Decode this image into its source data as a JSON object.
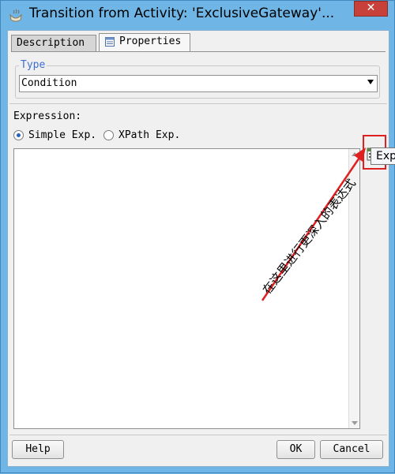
{
  "window": {
    "title": "Transition from Activity: 'ExclusiveGateway'...",
    "close_glyph": "✕"
  },
  "tabs": [
    {
      "label": "Description"
    },
    {
      "label": "Properties"
    }
  ],
  "type_group": {
    "legend": "Type",
    "selected": "Condition"
  },
  "expression": {
    "label": "Expression:",
    "options": [
      {
        "label": "Simple Exp.",
        "selected": true
      },
      {
        "label": "XPath Exp.",
        "selected": false
      }
    ],
    "value": ""
  },
  "tooltip": {
    "text": "Exp"
  },
  "annotation": {
    "text": "在这里进行更深入的表达式",
    "color": "#e02020"
  },
  "buttons": {
    "help": "Help",
    "ok": "OK",
    "cancel": "Cancel"
  }
}
